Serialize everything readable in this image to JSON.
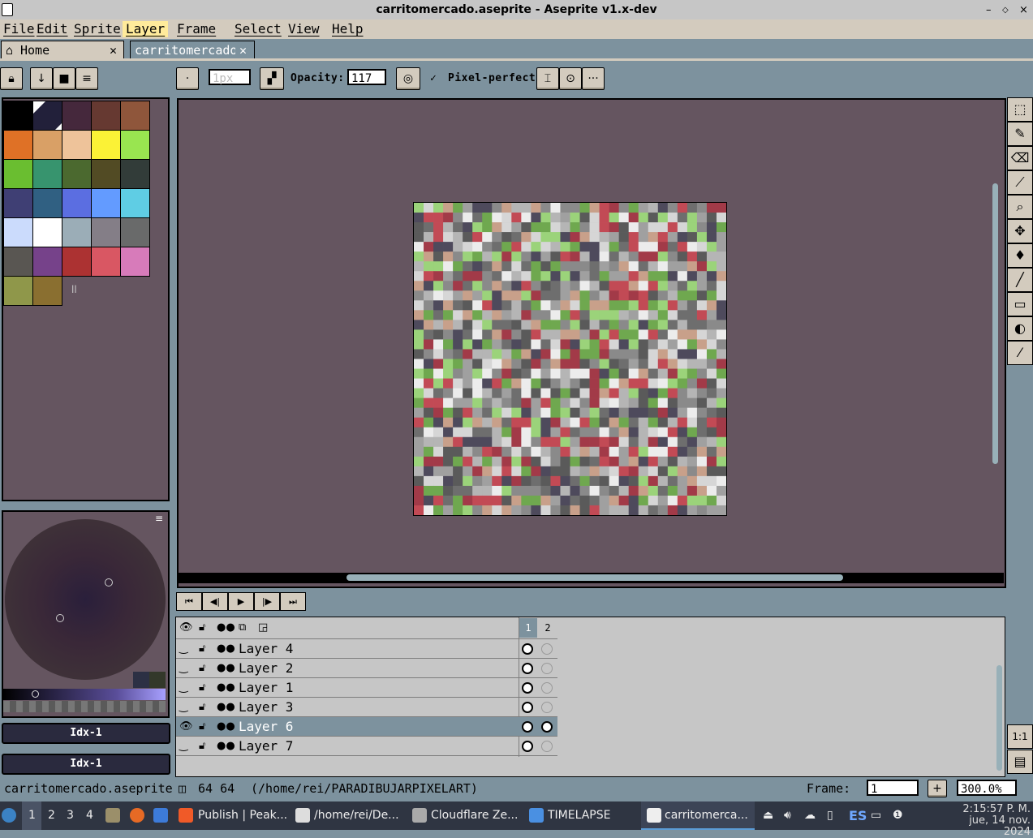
{
  "window": {
    "title": "carritomercado.aseprite - Aseprite v1.x-dev",
    "controls": [
      "–",
      "◇",
      "×"
    ]
  },
  "menu": [
    "File",
    "Edit",
    "Sprite",
    "Layer",
    "Frame",
    "Select",
    "View",
    "Help"
  ],
  "tabs": [
    {
      "label": "Home",
      "icon": "home-icon"
    },
    {
      "label": "carritomercado",
      "active": true
    }
  ],
  "toolbar": {
    "brush_size": "1px",
    "opacity_label": "Opacity:",
    "opacity_value": "117",
    "pixel_perfect_label": "Pixel-perfect",
    "pixel_perfect_checked": true,
    "more": "···"
  },
  "palette": {
    "colors": [
      "#000000",
      "#22203a",
      "#45283c",
      "#663931",
      "#8f563b",
      "#df7126",
      "#d9a066",
      "#eec39a",
      "#fbf236",
      "#99e550",
      "#6abe30",
      "#37946e",
      "#4b692f",
      "#524b24",
      "#323c39",
      "#3f3f74",
      "#306082",
      "#5b6ee1",
      "#639bff",
      "#5fcde4",
      "#cbdbfc",
      "#ffffff",
      "#9badb7",
      "#847e87",
      "#696a6a",
      "#595652",
      "#76428a",
      "#ac3232",
      "#d95763",
      "#d77bba",
      "#8f974a",
      "#8a6f30"
    ],
    "extra_glyph": "ll"
  },
  "color_indices": [
    "Idx-1",
    "Idx-1"
  ],
  "timeline": {
    "frames": [
      "1",
      "2"
    ],
    "layers": [
      {
        "name": "Layer 4",
        "visible": false,
        "selected": false,
        "frame2": false
      },
      {
        "name": "Layer 2",
        "visible": false,
        "selected": false,
        "frame2": false
      },
      {
        "name": "Layer 1",
        "visible": false,
        "selected": false,
        "frame2": false
      },
      {
        "name": "Layer 3",
        "visible": false,
        "selected": false,
        "frame2": false
      },
      {
        "name": "Layer 6",
        "visible": true,
        "selected": true,
        "frame2": true
      },
      {
        "name": "Layer 7",
        "visible": false,
        "selected": false,
        "frame2": false
      }
    ]
  },
  "status": {
    "filename": "carritomercado.aseprite",
    "size": "64 64",
    "path": "(/home/rei/PARADIBUJARPIXELART)",
    "frame_label": "Frame:",
    "frame_value": "1",
    "zoom": "300.0%"
  },
  "taskbar": {
    "workspaces": [
      "1",
      "2",
      "3",
      "4"
    ],
    "windows": [
      "Publish | Peak...",
      "/home/rei/De...",
      "Cloudflare Ze...",
      "TIMELAPSE",
      "carritomerca..."
    ],
    "lang": "ES",
    "time": "2:15:57 P. M.",
    "date": "jue, 14 nov. 2024"
  }
}
